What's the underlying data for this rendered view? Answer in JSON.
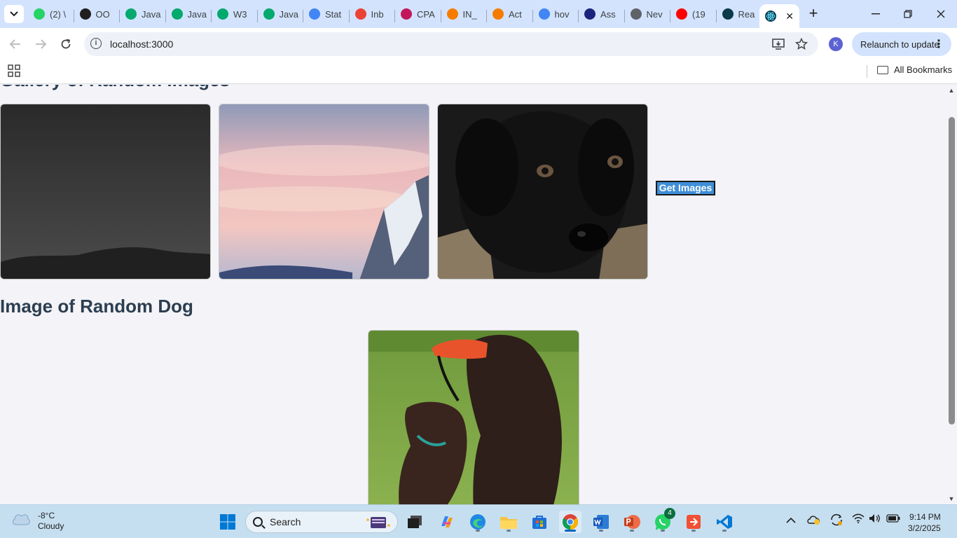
{
  "browser": {
    "tabs": [
      {
        "label": "(2) \\",
        "icon": "whatsapp-icon",
        "color": "#25d366"
      },
      {
        "label": "OO",
        "icon": "openai-icon",
        "color": "#1f1f1f"
      },
      {
        "label": "Java",
        "icon": "w3-icon",
        "color": "#04aa6d"
      },
      {
        "label": "Java",
        "icon": "w3-icon",
        "color": "#04aa6d"
      },
      {
        "label": "W3",
        "icon": "w3-icon",
        "color": "#04aa6d"
      },
      {
        "label": "Java",
        "icon": "w3-icon",
        "color": "#04aa6d"
      },
      {
        "label": "Stat",
        "icon": "docs-icon",
        "color": "#4285f4"
      },
      {
        "label": "Inb",
        "icon": "gmail-icon",
        "color": "#ea4335"
      },
      {
        "label": "CPA",
        "icon": "cpa-icon",
        "color": "#c2185b"
      },
      {
        "label": "IN_",
        "icon": "orange-logo-icon",
        "color": "#f57c00"
      },
      {
        "label": "Act",
        "icon": "orange-logo-icon",
        "color": "#f57c00"
      },
      {
        "label": "hov",
        "icon": "google-icon",
        "color": "#4285f4"
      },
      {
        "label": "Ass",
        "icon": "assessment-icon",
        "color": "#1a237e"
      },
      {
        "label": "Nev",
        "icon": "chrome-grey-icon",
        "color": "#5f6368"
      },
      {
        "label": "(19",
        "icon": "youtube-icon",
        "color": "#ff0000"
      },
      {
        "label": "Rea",
        "icon": "react-icon",
        "color": "#0b3a4a"
      }
    ],
    "active_tab": {
      "icon": "react-icon",
      "close": "✕"
    },
    "new_tab": "+",
    "url": "localhost:3000",
    "avatar_letter": "K",
    "relaunch_label": "Relaunch to update",
    "all_bookmarks": "All Bookmarks"
  },
  "page": {
    "cut_heading": "Gallery of Random Images",
    "get_images_button": "Get Images",
    "gallery_images": [
      {
        "name": "night-hills-image"
      },
      {
        "name": "pink-sky-mountain-image"
      },
      {
        "name": "black-puppy-image"
      }
    ],
    "dog_heading": "Image of Random Dog",
    "dog_image": "two-dogs-playing-image"
  },
  "taskbar": {
    "weather_temp": "-8°C",
    "weather_desc": "Cloudy",
    "search_placeholder": "Search",
    "whatsapp_badge": "4",
    "time": "9:14 PM",
    "date": "3/2/2025"
  },
  "colors": {
    "accent_button": "#3f8ed8",
    "heading": "#2c3e50",
    "tabstrip": "#d3e3fd",
    "taskbar": "#c6dff0"
  }
}
